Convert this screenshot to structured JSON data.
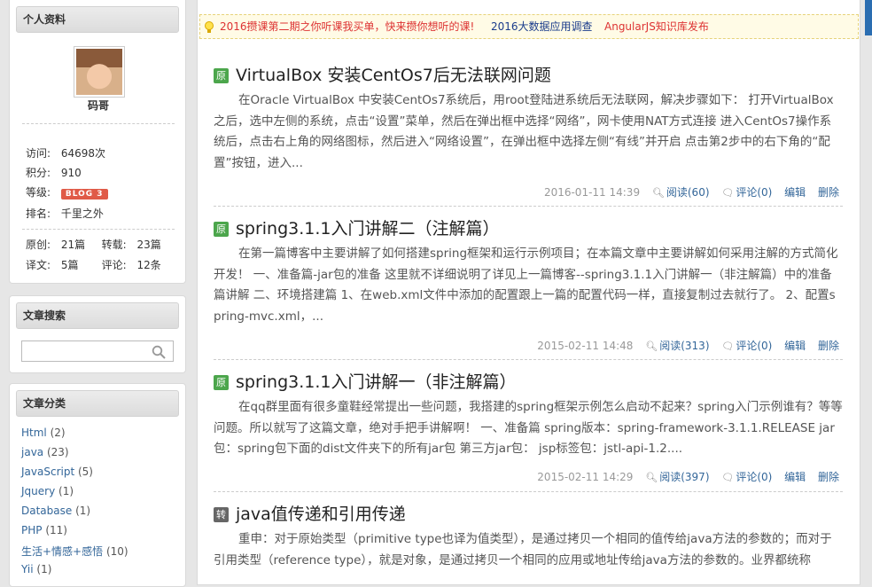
{
  "sidebar": {
    "profile": {
      "title": "个人资料",
      "nickname": "码哥",
      "visits_label": "访问:",
      "visits": "64698次",
      "points_label": "积分:",
      "points": "910",
      "level_label": "等级:",
      "level_badge": "BLOG 3",
      "rank_label": "排名:",
      "rank": "千里之外",
      "original_label": "原创:",
      "original": "21篇",
      "repost_label": "转载:",
      "repost": "23篇",
      "translation_label": "译文:",
      "translation": "5篇",
      "comments_label": "评论:",
      "comments": "12条"
    },
    "search": {
      "title": "文章搜索",
      "placeholder": ""
    },
    "categories": {
      "title": "文章分类",
      "items": [
        {
          "name": "Html",
          "count": "(2)"
        },
        {
          "name": "java",
          "count": "(23)"
        },
        {
          "name": "JavaScript",
          "count": "(5)"
        },
        {
          "name": "Jquery",
          "count": "(1)"
        },
        {
          "name": "Database",
          "count": "(1)"
        },
        {
          "name": "PHP",
          "count": "(11)"
        },
        {
          "name": "生活+情感+感悟",
          "count": "(10)"
        },
        {
          "name": "Yii",
          "count": "(1)"
        }
      ]
    }
  },
  "notice": {
    "link1": "2016攒课第二期之你听课我买单，快来攒你想听的课!",
    "link2": "2016大数据应用调查",
    "link3": "AngularJS知识库发布",
    "link1_color": "#d33",
    "link2_color": "#1a3c8c",
    "link3_color": "#d33"
  },
  "posts": [
    {
      "tag": "原",
      "title": "VirtualBox 安装CentOs7后无法联网问题",
      "summary": "在Oracle  VirtualBox 中安装CentOs7系统后，用root登陆进系统后无法联网，解决步骤如下：  打开VirtualBox之后，选中左侧的系统，点击“设置”菜单，然后在弹出框中选择“网络”，网卡使用NAT方式连接 进入CentOs7操作系统后，点击右上角的网络图标，然后进入“网络设置”，在弹出框中选择左侧“有线”并开启  点击第2步中的右下角的“配置”按钮，进入...",
      "date": "2016-01-11 14:39",
      "reads": "阅读(60)",
      "comments": "评论(0)",
      "edit": "编辑",
      "delete": "删除"
    },
    {
      "tag": "原",
      "title": "spring3.1.1入门讲解二（注解篇）",
      "summary": "在第一篇博客中主要讲解了如何搭建spring框架和运行示例项目；在本篇文章中主要讲解如何采用注解的方式简化开发！ 一、准备篇-jar包的准备    这里就不详细说明了详见上一篇博客--spring3.1.1入门讲解一（非注解篇）中的准备篇讲解 二、环境搭建篇      1、在web.xml文件中添加的配置跟上一篇的配置代码一样，直接复制过去就行了。  2、配置spring-mvc.xml，...",
      "date": "2015-02-11 14:48",
      "reads": "阅读(313)",
      "comments": "评论(0)",
      "edit": "编辑",
      "delete": "删除"
    },
    {
      "tag": "原",
      "title": "spring3.1.1入门讲解一（非注解篇）",
      "summary": "在qq群里面有很多童鞋经常提出一些问题，我搭建的spring框架示例怎么启动不起来？spring入门示例谁有？等等问题。所以就写了这篇文章，绝对手把手讲解啊！ 一、准备篇 spring版本：spring-framework-3.1.1.RELEASE jar包：spring包下面的dist文件夹下的所有jar包        第三方jar包：  jsp标签包：jstl-api-1.2....",
      "date": "2015-02-11 14:29",
      "reads": "阅读(397)",
      "comments": "评论(0)",
      "edit": "编辑",
      "delete": "删除"
    },
    {
      "tag": "转",
      "title": "java值传递和引用传递",
      "summary": "重申：对于原始类型（primitive type也译为值类型），是通过拷贝一个相同的值传给java方法的参数的；而对于引用类型（reference type），就是对象，是通过拷贝一个相同的应用或地址传给java方法的参数的。业界都统称"
    }
  ]
}
